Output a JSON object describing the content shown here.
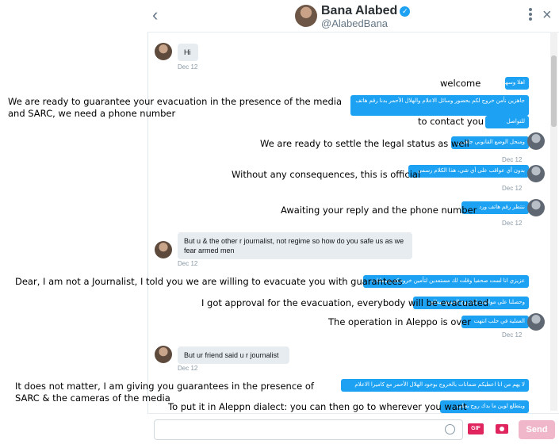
{
  "header": {
    "name": "Bana Alabed",
    "handle": "@AlabedBana",
    "back_icon": "‹",
    "close_icon": "×"
  },
  "messages": {
    "m1": {
      "text": "Hi",
      "time": "Dec 12"
    },
    "out1_a": "اهلا وسهلا",
    "out1_b": "جاهزين نأمن خروج لكم بحضور وسائل الاعلام والهلال الأحمر بدنا رقم هاتف",
    "out1_c": "للتواصل",
    "out2": "ومنحل الوضع القانوني جاهزين",
    "out3": "بدون أي عواقب على أي شي، هذا الكلام رسمي",
    "out4": "ننتظر رقم هاتف ورد",
    "m2": {
      "text": "But u & the other r journalist, not regime so how do you safe us as we fear armed men",
      "time": "Dec 12"
    },
    "out5_a": "عزيزي انا لست صحفيا وقلت لك مستعدين لتأمين خروجكم بضمانات",
    "out5_b": "وحصلنا على موافقة بالخروج الجميع بيطلع",
    "out5_c": "العملية في حلب انتهت",
    "m3": {
      "text": "But ur friend said u r journalist",
      "time": "Dec 12"
    },
    "out6_a": "لا يهم من انا اعطيكم ضمانات بالخروج بوجود الهلال الأحمر مع كاميرا الاعلام",
    "out6_b": "وبتطلع لوين ما بدك روح بحلب",
    "times": {
      "t1": "Dec 12",
      "t2": "Dec 12",
      "t3": "Dec 12",
      "t4": "Dec 12",
      "t5": "Dec 12"
    }
  },
  "translations": {
    "welcome": "welcome",
    "guarantee": "We are ready to guarantee your evacuation in the presence of the media and SARC, we need a phone number",
    "contact": "to contact you",
    "legal": "We are ready to settle the legal status as well",
    "official": "Without any consequences, this is official",
    "awaiting": "Awaiting your reply and the phone number",
    "dear": "Dear, I am not a Journalist, I told you we are willing to evacuate you with guarantees",
    "approval": "I got approval for the evacuation, everybody will be evacuated",
    "operation": "The operation in Aleppo is over",
    "matter": "It does not matter, I am giving you guarantees in the presence of SARC & the cameras of the media",
    "dialect": "To put it in Aleppn dialect: you can then go to wherever you want"
  },
  "compose": {
    "gif_label": "GIF",
    "send_label": "Send"
  },
  "colors": {
    "accent": "#1da1f2",
    "send": "#f0b6c9",
    "gif": "#e0245e"
  }
}
